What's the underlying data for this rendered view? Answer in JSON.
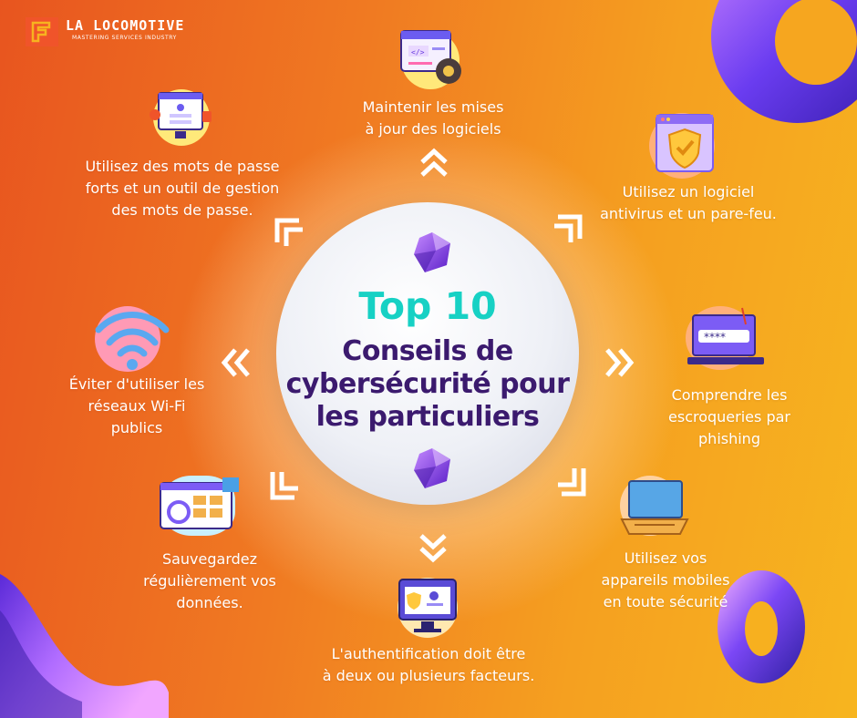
{
  "logo": {
    "name": "LA LOCOMOTIVE",
    "tagline": "MASTERING SERVICES INDUSTRY"
  },
  "center": {
    "title": "Top 10",
    "subtitle_line1": "Conseils de",
    "subtitle_line2": "cybersécurité pour",
    "subtitle_line3": "les particuliers"
  },
  "tips": {
    "updates": {
      "line1": "Maintenir les mises",
      "line2": "à jour des logiciels",
      "icon": "code-settings-icon"
    },
    "antivirus": {
      "line1": "Utilisez un logiciel",
      "line2": "antivirus et un pare-feu.",
      "icon": "shield-browser-icon"
    },
    "phishing": {
      "line1": "Comprendre les",
      "line2": "escroqueries par",
      "line3": "phishing",
      "icon": "password-laptop-icon"
    },
    "mobile": {
      "line1": "Utilisez vos",
      "line2": "appareils mobiles",
      "line3": "en toute sécurité",
      "icon": "laptop-icon"
    },
    "mfa": {
      "line1": "L'authentification doit être",
      "line2": "à deux ou plusieurs facteurs.",
      "icon": "profile-shield-icon"
    },
    "backup": {
      "line1": "Sauvegardez",
      "line2": "régulièrement vos",
      "line3": "données.",
      "icon": "backup-dashboard-icon"
    },
    "wifi": {
      "line1": "Éviter d'utiliser les",
      "line2": "réseaux Wi-Fi",
      "line3": "publics",
      "icon": "wifi-icon"
    },
    "passwords": {
      "line1": "Utilisez des mots de passe",
      "line2": "forts et un outil de gestion",
      "line3": "des mots de passe.",
      "icon": "login-screen-icon"
    }
  },
  "colors": {
    "accent_teal": "#17d1c4",
    "title_purple": "#3b1a6e",
    "background_orange": "#f07a22",
    "gem_purple": "#8a3fe0"
  }
}
